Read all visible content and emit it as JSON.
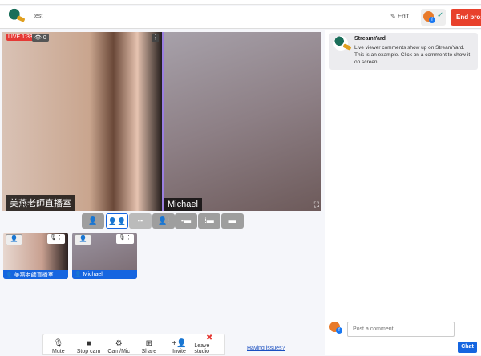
{
  "header": {
    "title": "test",
    "edit_label": "Edit",
    "end_label": "End broadcast"
  },
  "stage": {
    "live_label": "LIVE 1:33",
    "viewers": "0",
    "participants": [
      {
        "name": "美燕老師直播室"
      },
      {
        "name": "Michael"
      }
    ]
  },
  "layouts": [
    "single",
    "two-split",
    "two-small",
    "group",
    "side",
    "pip",
    "full"
  ],
  "thumbnails": [
    {
      "name": "美燕老師直播室"
    },
    {
      "name": "Michael"
    }
  ],
  "toolbar": [
    {
      "label": "Mute",
      "icon": "mic-icon",
      "glyph": "🎙"
    },
    {
      "label": "Stop cam",
      "icon": "camera-icon",
      "glyph": "■"
    },
    {
      "label": "Cam/Mic",
      "icon": "gear-icon",
      "glyph": "⚙"
    },
    {
      "label": "Share",
      "icon": "screen-share-icon",
      "glyph": "⊞"
    },
    {
      "label": "Invite",
      "icon": "add-person-icon",
      "glyph": "+👤"
    },
    {
      "label": "Leave studio",
      "icon": "leave-icon",
      "glyph": "✖"
    }
  ],
  "help_link": "Having issues?",
  "comments": {
    "author": "StreamYard",
    "text": "Live viewer comments show up on StreamYard. This is an example. Click on a comment to show it on screen.",
    "placeholder": "Post a comment",
    "chat_label": "Chat"
  },
  "colors": {
    "accent": "#1565e0",
    "danger": "#e8412c"
  }
}
